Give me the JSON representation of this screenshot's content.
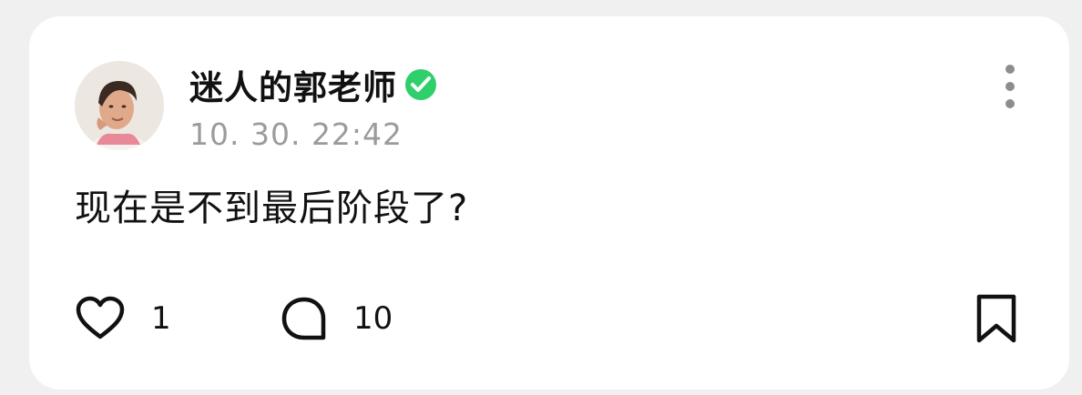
{
  "post": {
    "author": {
      "name": "迷人的郭老师",
      "verified_icon": "verified-check-icon",
      "verified_color": "#2fcf6b"
    },
    "timestamp": "10. 30. 22:42",
    "text": "现在是不到最后阶段了?",
    "actions": {
      "like": {
        "icon": "heart-icon",
        "count": "1"
      },
      "comment": {
        "icon": "comment-bubble-icon",
        "count": "10"
      },
      "bookmark": {
        "icon": "bookmark-icon"
      },
      "more": {
        "icon": "more-vertical-icon"
      }
    }
  },
  "colors": {
    "background": "#f0f0f0",
    "card": "#ffffff",
    "text": "#111111",
    "muted": "#9b9b9b"
  }
}
